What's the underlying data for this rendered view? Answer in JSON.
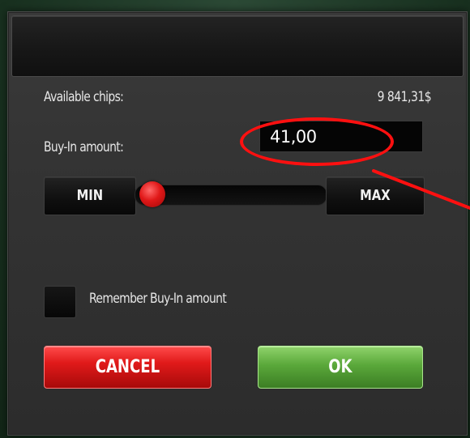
{
  "dialog": {
    "available_label": "Available chips:",
    "available_value": "9 841,31$",
    "buyin_label": "Buy-In amount:",
    "buyin_value": "41,00",
    "min_label": "MIN",
    "max_label": "MAX",
    "slider_level": 0.15,
    "remember_label": "Remember Buy-In amount",
    "remember_checked": false,
    "cancel_label": "CANCEL",
    "ok_label": "OK"
  },
  "colors": {
    "cancel": "#e01a1a",
    "ok": "#5aa83a",
    "slider_knob": "#e01818",
    "annotation": "#ff1010"
  }
}
